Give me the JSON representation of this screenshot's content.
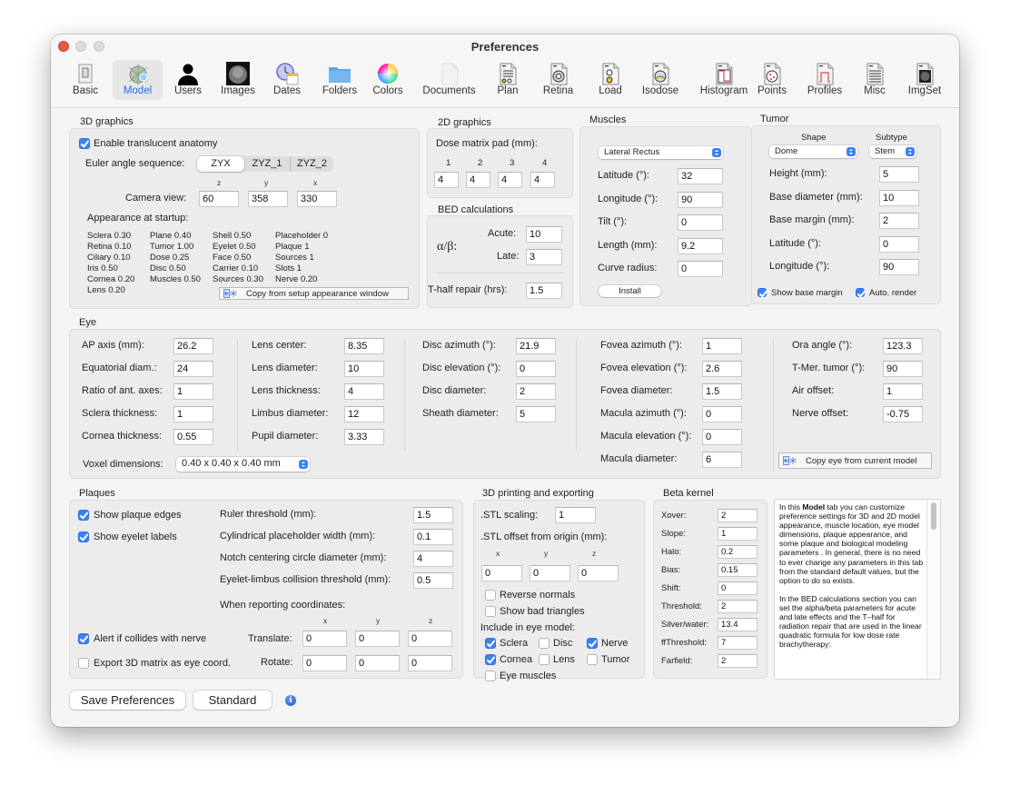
{
  "window": {
    "title": "Preferences"
  },
  "toolbar": {
    "items": [
      {
        "label": "Basic",
        "icon": "switch-icon"
      },
      {
        "label": "Model",
        "icon": "eye-model-icon",
        "selected": true
      },
      {
        "label": "Users",
        "icon": "user-icon"
      },
      {
        "label": "Images",
        "icon": "fundus-image-icon"
      },
      {
        "label": "Dates",
        "icon": "clock-calendar-icon"
      },
      {
        "label": "Folders",
        "icon": "folder-icon"
      },
      {
        "label": "Colors",
        "icon": "color-wheel-icon"
      },
      {
        "label": "Documents",
        "icon": "document-icon"
      },
      {
        "label": "Plan",
        "icon": "plan-doc-icon"
      },
      {
        "label": "Retina",
        "icon": "retina-doc-icon"
      },
      {
        "label": "Load",
        "icon": "load-doc-icon"
      },
      {
        "label": "Isodose",
        "icon": "isodose-doc-icon"
      },
      {
        "label": "Histogram",
        "icon": "histogram-doc-icon"
      },
      {
        "label": "Points",
        "icon": "points-doc-icon"
      },
      {
        "label": "Profiles",
        "icon": "profiles-doc-icon"
      },
      {
        "label": "Misc",
        "icon": "misc-doc-icon"
      },
      {
        "label": "ImgSet",
        "icon": "imgset-doc-icon"
      }
    ]
  },
  "graphics3d": {
    "title": "3D graphics",
    "translucent_label": "Enable translucent anatomy",
    "translucent_checked": true,
    "euler_label": "Euler angle sequence:",
    "euler_options": [
      "ZYX",
      "ZYZ_1",
      "ZYZ_2"
    ],
    "euler_selected": "ZYX",
    "axis_labels": [
      "z",
      "y",
      "x"
    ],
    "camera_label": "Camera view:",
    "camera_values": [
      "60",
      "358",
      "330"
    ],
    "appearance_label": "Appearance at startup:",
    "appearance_cols": [
      [
        "Sclera 0.30",
        "Retina 0.10",
        "Ciliary 0.10",
        "Iris 0.50",
        "Cornea 0.20",
        "Lens 0.20"
      ],
      [
        "Plane 0.40",
        "Tumor 1.00",
        "Dose 0.25",
        "Disc 0.50",
        "Muscles 0.50"
      ],
      [
        "Shell 0.50",
        "Eyelet 0.50",
        "Face 0.50",
        "Carrier 0.10",
        "Sources 0.30"
      ],
      [
        "Placeholder 0",
        "Plaque 1",
        "Sources 1",
        "Slots 1",
        "Nerve 0.20"
      ]
    ],
    "copy_button": "Copy from setup appearance window"
  },
  "graphics2d": {
    "title": "2D graphics",
    "pad_label": "Dose matrix pad (mm):",
    "pad_headers": [
      "1",
      "2",
      "3",
      "4"
    ],
    "pad_values": [
      "4",
      "4",
      "4",
      "4"
    ]
  },
  "bed": {
    "title": "BED calculations",
    "ab_label": "α/β:",
    "acute_label": "Acute:",
    "acute_value": "10",
    "late_label": "Late:",
    "late_value": "3",
    "thalf_label": "T-half repair (hrs):",
    "thalf_value": "1.5"
  },
  "muscles": {
    "title": "Muscles",
    "selected_muscle": "Lateral Rectus",
    "fields": [
      {
        "label": "Latitude (°):",
        "value": "32"
      },
      {
        "label": "Longitude (°):",
        "value": "90"
      },
      {
        "label": "Tilt (°):",
        "value": "0"
      },
      {
        "label": "Length (mm):",
        "value": "9.2"
      },
      {
        "label": "Curve radius:",
        "value": "0"
      }
    ],
    "install_button": "Install"
  },
  "tumor": {
    "title": "Tumor",
    "shape_header": "Shape",
    "subtype_header": "Subtype",
    "shape_value": "Dome",
    "subtype_value": "Stem",
    "fields": [
      {
        "label": "Height (mm):",
        "value": "5"
      },
      {
        "label": "Base diameter (mm):",
        "value": "10"
      },
      {
        "label": "Base margin (mm):",
        "value": "2"
      },
      {
        "label": "Latitude (°):",
        "value": "0"
      },
      {
        "label": "Longitude (°):",
        "value": "90"
      }
    ],
    "show_base_margin_label": "Show base margin",
    "show_base_margin_checked": true,
    "auto_render_label": "Auto. render",
    "auto_render_checked": true
  },
  "eye": {
    "title": "Eye",
    "col1": [
      {
        "label": "AP axis (mm):",
        "value": "26.2"
      },
      {
        "label": "Equatorial diam.:",
        "value": "24"
      },
      {
        "label": "Ratio of ant. axes:",
        "value": "1"
      },
      {
        "label": "Sclera thickness:",
        "value": "1"
      },
      {
        "label": "Cornea thickness:",
        "value": "0.55"
      }
    ],
    "col2": [
      {
        "label": "Lens center:",
        "value": "8.35"
      },
      {
        "label": "Lens diameter:",
        "value": "10"
      },
      {
        "label": "Lens thickness:",
        "value": "4"
      },
      {
        "label": "Limbus diameter:",
        "value": "12"
      },
      {
        "label": "Pupil diameter:",
        "value": "3.33"
      }
    ],
    "col3": [
      {
        "label": "Disc azimuth (°):",
        "value": "21.9"
      },
      {
        "label": "Disc elevation (°):",
        "value": "0"
      },
      {
        "label": "Disc diameter:",
        "value": "2"
      },
      {
        "label": "Sheath diameter:",
        "value": "5"
      }
    ],
    "col4": [
      {
        "label": "Fovea azimuth (°):",
        "value": "1"
      },
      {
        "label": "Fovea elevation (°):",
        "value": "2.6"
      },
      {
        "label": "Fovea diameter:",
        "value": "1.5"
      },
      {
        "label": "Macula azimuth (°):",
        "value": "0"
      },
      {
        "label": "Macula elevation (°):",
        "value": "0"
      },
      {
        "label": "Macula diameter:",
        "value": "6"
      }
    ],
    "col5": [
      {
        "label": "Ora angle (°):",
        "value": "123.3"
      },
      {
        "label": "T-Mer. tumor (°):",
        "value": "90"
      },
      {
        "label": "Air offset:",
        "value": "1"
      },
      {
        "label": "Nerve offset:",
        "value": "-0.75"
      }
    ],
    "voxel_label": "Voxel dimensions:",
    "voxel_value": "0.40 x 0.40 x 0.40 mm",
    "copy_button": "Copy eye from current model"
  },
  "plaques": {
    "title": "Plaques",
    "show_edges_label": "Show plaque edges",
    "show_edges_checked": true,
    "show_eyelet_label": "Show eyelet labels",
    "show_eyelet_checked": true,
    "alert_label": "Alert if collides with nerve",
    "alert_checked": true,
    "export_label": "Export 3D matrix as eye coord.",
    "export_checked": false,
    "fields": [
      {
        "label": "Ruler threshold (mm):",
        "value": "1.5"
      },
      {
        "label": "Cylindrical placeholder width (mm):",
        "value": "0.1"
      },
      {
        "label": "Notch centering circle diameter (mm):",
        "value": "4"
      },
      {
        "label": "Eyelet-limbus collision threshold (mm):",
        "value": "0.5"
      }
    ],
    "coords_label": "When reporting coordinates:",
    "axis_labels": [
      "x",
      "y",
      "z"
    ],
    "translate_label": "Translate:",
    "translate_values": [
      "0",
      "0",
      "0"
    ],
    "rotate_label": "Rotate:",
    "rotate_values": [
      "0",
      "0",
      "0"
    ]
  },
  "printing": {
    "title": "3D printing and exporting",
    "scaling_label": ".STL scaling:",
    "scaling_value": "1",
    "offset_label": ".STL offset from origin (mm):",
    "axis_labels": [
      "x",
      "y",
      "z"
    ],
    "offset_values": [
      "0",
      "0",
      "0"
    ],
    "reverse_normals_label": "Reverse normals",
    "reverse_normals_checked": false,
    "bad_triangles_label": "Show bad triangles",
    "bad_triangles_checked": false,
    "include_label": "Include in eye model:",
    "include": [
      {
        "label": "Sclera",
        "checked": true
      },
      {
        "label": "Disc",
        "checked": false
      },
      {
        "label": "Nerve",
        "checked": true
      },
      {
        "label": "Cornea",
        "checked": true
      },
      {
        "label": "Lens",
        "checked": false
      },
      {
        "label": "Tumor",
        "checked": false
      },
      {
        "label": "Eye muscles",
        "checked": false
      }
    ]
  },
  "beta": {
    "title": "Beta kernel",
    "fields": [
      {
        "label": "Xover:",
        "value": "2"
      },
      {
        "label": "Slope:",
        "value": "1"
      },
      {
        "label": "Halo:",
        "value": "0.2"
      },
      {
        "label": "Bias:",
        "value": "0.15"
      },
      {
        "label": "Shift:",
        "value": "0"
      },
      {
        "label": "Threshold:",
        "value": "2"
      },
      {
        "label": "Silver/water:",
        "value": "13.4"
      },
      {
        "label": "ffThreshold:",
        "value": "7"
      },
      {
        "label": "Farfield:",
        "value": "2"
      }
    ]
  },
  "help": {
    "p1_pre": "In this ",
    "p1_bold": "Model",
    "p1_post": " tab you can customize preference settings for 3D and 2D model appearance, muscle location, eye model dimensions, plaque appearance, and some plaque and biological modeling parameters . In general, there is no need to ever change any parameters in this tab from the standard default values, but the option to do so exists.",
    "p2": "In the BED calculations section you can set the alpha/beta parameters for acute and late effects and the T–half for radiation repair that are used in the linear quadratic formula for low dose rate brachytherapy:"
  },
  "footer": {
    "save_button": "Save Preferences",
    "standard_button": "Standard",
    "info_icon": "info-icon"
  }
}
